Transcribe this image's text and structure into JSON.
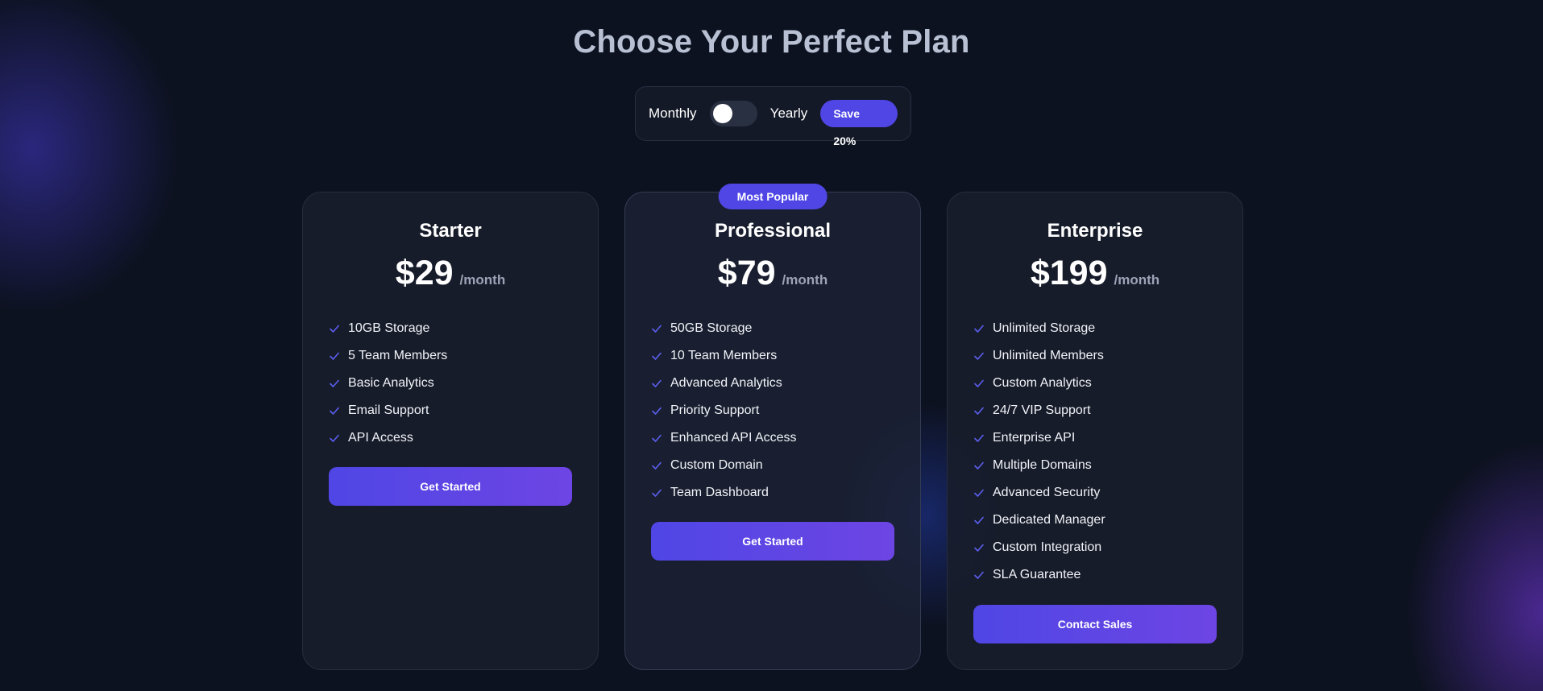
{
  "header": {
    "title": "Choose Your Perfect Plan"
  },
  "billing": {
    "monthly_label": "Monthly",
    "yearly_label": "Yearly",
    "save_badge": "Save 20%",
    "selected": "monthly"
  },
  "plans": [
    {
      "name": "Starter",
      "price": "$29",
      "period": "/month",
      "features": [
        "10GB Storage",
        "5 Team Members",
        "Basic Analytics",
        "Email Support",
        "API Access"
      ],
      "cta": "Get Started"
    },
    {
      "name": "Professional",
      "badge": "Most Popular",
      "price": "$79",
      "period": "/month",
      "features": [
        "50GB Storage",
        "10 Team Members",
        "Advanced Analytics",
        "Priority Support",
        "Enhanced API Access",
        "Custom Domain",
        "Team Dashboard"
      ],
      "cta": "Get Started"
    },
    {
      "name": "Enterprise",
      "price": "$199",
      "period": "/month",
      "features": [
        "Unlimited Storage",
        "Unlimited Members",
        "Custom Analytics",
        "24/7 VIP Support",
        "Enterprise API",
        "Multiple Domains",
        "Advanced Security",
        "Dedicated Manager",
        "Custom Integration",
        "SLA Guarantee"
      ],
      "cta": "Contact Sales"
    }
  ],
  "colors": {
    "accent": "#4f46e5",
    "accent_end": "#6d45e4",
    "background": "#0d1220",
    "card": "#181d2b",
    "check": "#5b5ff0"
  }
}
